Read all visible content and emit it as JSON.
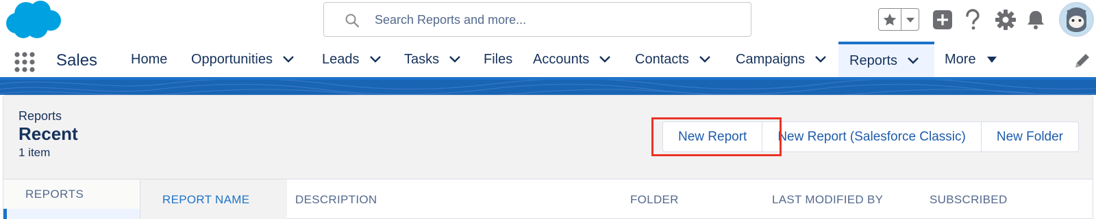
{
  "header": {
    "search_placeholder": "Search Reports and more...",
    "icons": [
      "salesforce-cloud-logo",
      "search-icon",
      "favorites-star-icon",
      "favorites-dropdown-icon",
      "global-add-icon",
      "help-icon",
      "setup-gear-icon",
      "notifications-bell-icon",
      "user-avatar"
    ]
  },
  "nav": {
    "app_name": "Sales",
    "items": [
      {
        "label": "Home"
      },
      {
        "label": "Opportunities"
      },
      {
        "label": "Leads"
      },
      {
        "label": "Tasks"
      },
      {
        "label": "Files"
      },
      {
        "label": "Accounts"
      },
      {
        "label": "Contacts"
      },
      {
        "label": "Campaigns"
      },
      {
        "label": "Reports"
      },
      {
        "label": "More"
      }
    ],
    "active": "Reports"
  },
  "list_view": {
    "object_name": "Reports",
    "title": "Recent",
    "count": "1 item",
    "buttons": [
      "New Report",
      "New Report (Salesforce Classic)",
      "New Folder"
    ],
    "highlighted_button": "New Report"
  },
  "side_nav": {
    "heading": "REPORTS"
  },
  "table": {
    "columns": [
      "REPORT NAME",
      "DESCRIPTION",
      "FOLDER",
      "LAST MODIFIED BY",
      "SUBSCRIBED"
    ],
    "sorted_column": "REPORT NAME"
  },
  "colors": {
    "brand_blue": "#1d73c9",
    "banner_blue": "#1a64b4",
    "link_blue": "#1d5cab",
    "text_navy": "#16325c",
    "highlight_red": "#ea3323",
    "header_gray": "#f3f2f2"
  }
}
